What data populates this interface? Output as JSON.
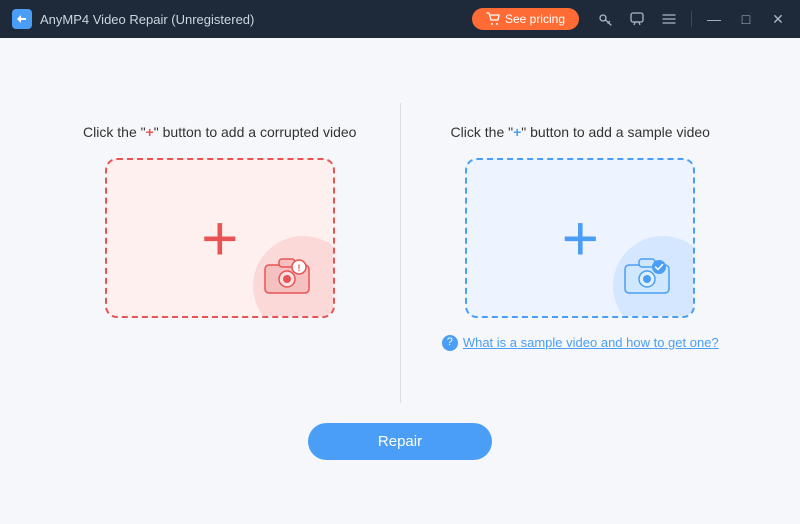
{
  "titlebar": {
    "title": "AnyMP4 Video Repair (Unregistered)",
    "see_pricing_label": "See pricing",
    "window_controls": {
      "minimize": "—",
      "maximize": "□",
      "close": "✕"
    }
  },
  "left_panel": {
    "instruction_pre": "Click the \"",
    "instruction_plus": "+",
    "instruction_post": "\" button to add a corrupted video"
  },
  "right_panel": {
    "instruction_pre": "Click the \"",
    "instruction_plus": "+",
    "instruction_post": "\" button to add a sample video",
    "help_link": "What is a sample video and how to get one?"
  },
  "repair_button": {
    "label": "Repair"
  }
}
